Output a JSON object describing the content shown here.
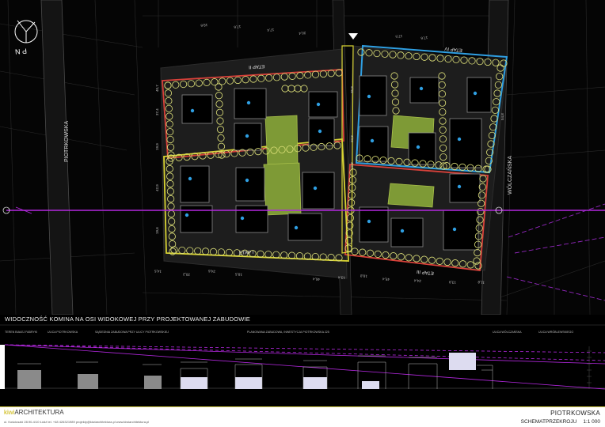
{
  "plan": {
    "north_label": "P N",
    "street_left": "PIOTRKOWSKA",
    "street_right": "WÓLCZAŃSKA",
    "etap_labels": [
      "ETAP I",
      "ETAP II",
      "ETAP III",
      "ETAP IV"
    ],
    "dims_top": [
      "19,6",
      "17,6",
      "17,4",
      "20,4",
      "17,5",
      "17,6"
    ],
    "dims_mid": [
      "35,8",
      "22,8",
      "19,8",
      "54,8"
    ],
    "dims_left": [
      "40,7",
      "37,4",
      "19,9",
      "42,9",
      "19,6"
    ],
    "dims_bottom": [
      "14,5",
      "20,2",
      "24,6",
      "19,5",
      "46,4",
      "13,4",
      "19,8",
      "45,4",
      "24,4",
      "13,9",
      "11,8"
    ],
    "colors": {
      "etap1": "#d7d232",
      "etap2": "#d8413a",
      "etap3": "#d8413a",
      "etap4": "#2f9fe2",
      "axis": "#b428e0"
    }
  },
  "section": {
    "title": "WIDOCZNOŚĆ KOMINA NA OSI WIDOKOWEJ PRZY PROJEKTOWANEJ ZABUDOWIE",
    "labels": [
      "TEREN BIAŁEJ FABRYKI",
      "ULICA PIOTRKOWSKA",
      "SĄSIEDNIA ZABUDOWA PRZY ULICY PIOTRKOWSKIEJ",
      "PLANOWANA ZABUDOWA, INWESTYCJA PIOTRKOWSKA 225",
      "ULICA WÓLCZAŃSKA",
      "ULICA WRÓBLEWSKIEGO"
    ]
  },
  "footer": {
    "logo_prefix": "kiwi",
    "logo_main": "ARCHITEKTURA",
    "address": "ul. Kościuszki 28.90-4/10 Łódź    tel. +48 426321989    projekty@kiwiarchitektura.pl    www.kiwiarchitektura.pl",
    "project": "PIOTRKOWSKA",
    "drawing": "SCHEMATPRZEKROJU",
    "scale": "1:1 000"
  }
}
